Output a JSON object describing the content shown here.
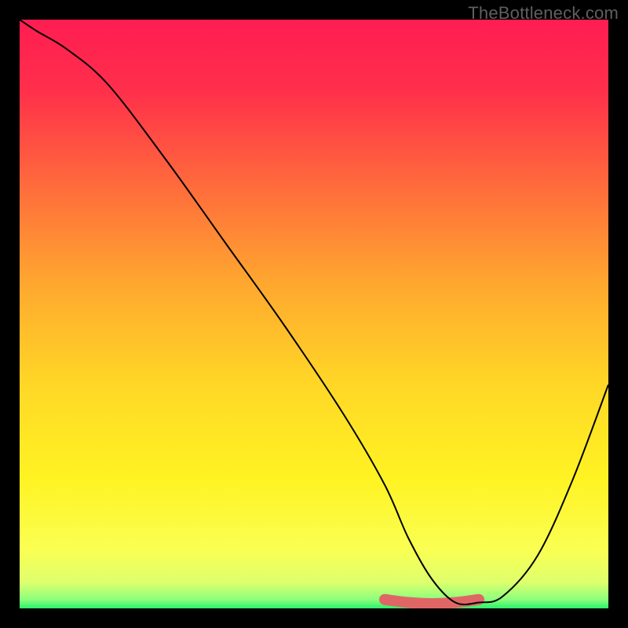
{
  "watermark": "TheBottleneck.com",
  "chart_data": {
    "type": "line",
    "title": "",
    "xlabel": "",
    "ylabel": "",
    "xlim": [
      0,
      100
    ],
    "ylim": [
      0,
      100
    ],
    "grid": false,
    "series": [
      {
        "name": "bottleneck-curve",
        "x": [
          0,
          3,
          8,
          15,
          25,
          35,
          45,
          55,
          62,
          66,
          70,
          74,
          78,
          82,
          88,
          94,
          100
        ],
        "values": [
          100,
          98,
          95,
          89,
          76,
          62,
          48,
          33,
          21,
          12,
          5,
          1,
          1,
          2,
          9,
          22,
          38
        ]
      },
      {
        "name": "recommended-range-highlight",
        "x": [
          62,
          66,
          70,
          74,
          78
        ],
        "values": [
          1.5,
          1.0,
          0.8,
          1.0,
          1.5
        ]
      }
    ],
    "background_gradient_stops": [
      {
        "offset": 0.0,
        "color": "#ff1d52"
      },
      {
        "offset": 0.12,
        "color": "#ff2f4b"
      },
      {
        "offset": 0.28,
        "color": "#ff6a3c"
      },
      {
        "offset": 0.45,
        "color": "#ffa82f"
      },
      {
        "offset": 0.62,
        "color": "#ffd726"
      },
      {
        "offset": 0.78,
        "color": "#fff323"
      },
      {
        "offset": 0.9,
        "color": "#faff52"
      },
      {
        "offset": 0.955,
        "color": "#dfff6d"
      },
      {
        "offset": 0.985,
        "color": "#8cff7d"
      },
      {
        "offset": 1.0,
        "color": "#2bf06b"
      }
    ],
    "highlight_color": "#e06666",
    "curve_color": "#000000"
  }
}
